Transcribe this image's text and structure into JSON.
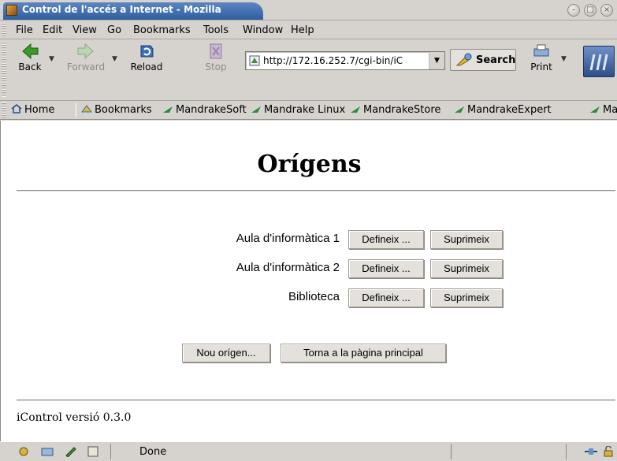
{
  "window": {
    "title": "Control de l'accés a Internet - Mozilla",
    "controls": [
      "minimize",
      "maximize",
      "close"
    ]
  },
  "menubar": {
    "items": [
      "File",
      "Edit",
      "View",
      "Go",
      "Bookmarks",
      "Tools",
      "Window",
      "Help"
    ]
  },
  "toolbar": {
    "back_label": "Back",
    "forward_label": "Forward",
    "reload_label": "Reload",
    "stop_label": "Stop",
    "url": "http://172.16.252.7/cgi-bin/iC",
    "search_label": "Search",
    "print_label": "Print"
  },
  "personal_toolbar": {
    "home_label": "Home",
    "bookmarks_label": "Bookmarks",
    "links": [
      "MandrakeSoft",
      "Mandrake Linux",
      "MandrakeStore",
      "MandrakeExpert",
      "Ma"
    ]
  },
  "page": {
    "title": "Orígens",
    "origins": [
      {
        "name": "Aula d'informàtica 1",
        "define_label": "Defineix ...",
        "delete_label": "Suprimeix"
      },
      {
        "name": "Aula d'informàtica 2",
        "define_label": "Defineix ...",
        "delete_label": "Suprimeix"
      },
      {
        "name": "Biblioteca",
        "define_label": "Defineix ...",
        "delete_label": "Suprimeix"
      }
    ],
    "new_origin_label": "Nou orígen...",
    "back_to_main_label": "Torna a la pàgina principal",
    "footer": "iControl versió 0.3.0"
  },
  "statusbar": {
    "text": "Done"
  },
  "colors": {
    "chrome": "#d6d3ce",
    "title_active": "#2f5d9e",
    "page_background": "#ffffff"
  }
}
